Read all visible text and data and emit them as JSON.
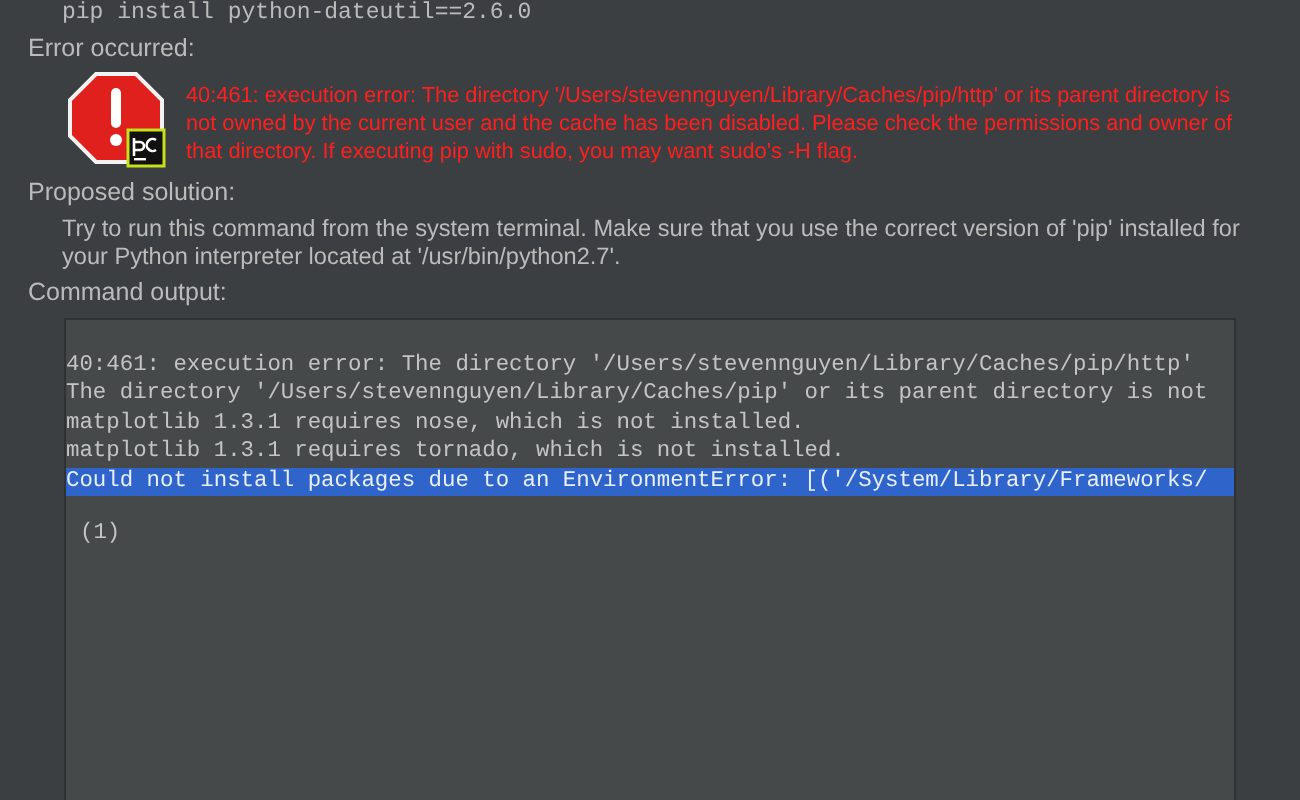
{
  "command": "pip install python-dateutil==2.6.0",
  "error": {
    "label": "Error occurred:",
    "message": "40:461: execution error: The directory '/Users/stevennguyen/Library/Caches/pip/http' or its parent directory is not owned by the current user and the cache has been disabled. Please check the permissions and owner of that directory. If executing pip with sudo, you may want sudo's -H flag."
  },
  "solution": {
    "label": "Proposed solution:",
    "text": "Try to run this command from the system terminal. Make sure that you use the correct version of 'pip' installed for your Python interpreter located at '/usr/bin/python2.7'."
  },
  "output": {
    "label": "Command output:",
    "lines": [
      {
        "text": "40:461: execution error: The directory '/Users/stevennguyen/Library/Caches/pip/http'",
        "selected": false
      },
      {
        "text": "The directory '/Users/stevennguyen/Library/Caches/pip' or its parent directory is not",
        "selected": false
      },
      {
        "text": "matplotlib 1.3.1 requires nose, which is not installed.",
        "selected": false
      },
      {
        "text": "matplotlib 1.3.1 requires tornado, which is not installed.",
        "selected": false
      },
      {
        "text": "Could not install packages due to an EnvironmentError: [('/System/Library/Frameworks/",
        "selected": true
      }
    ],
    "exit_code": "(1)"
  }
}
